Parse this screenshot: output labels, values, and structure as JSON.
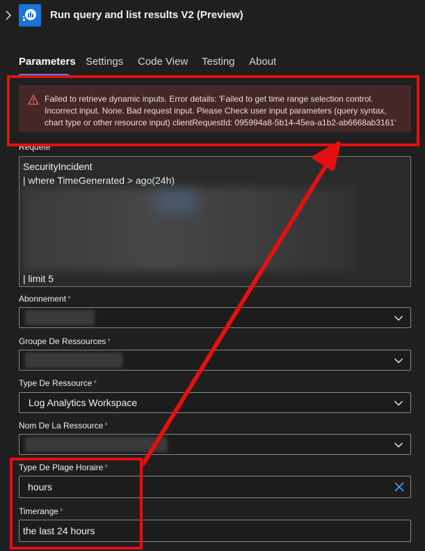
{
  "header": {
    "title": "Run query and list results V2 (Preview)"
  },
  "tabs": [
    {
      "label": "Parameters",
      "active": true
    },
    {
      "label": "Settings",
      "active": false
    },
    {
      "label": "Code View",
      "active": false
    },
    {
      "label": "Testing",
      "active": false
    },
    {
      "label": "About",
      "active": false
    }
  ],
  "error": {
    "message": "Failed to retrieve dynamic inputs. Error details: 'Failed to get time range selection control. Incorrect input. None. Bad request input. Please Check user input parameters (query syntax, chart type or other resource input) clientRequestId: 095994a8-5b14-45ea-a1b2-ab6668ab3161'"
  },
  "query": {
    "label": "Requete",
    "line1": "SecurityIncident",
    "line2": "| where TimeGenerated > ago(24h)",
    "line_last": "| limit 5"
  },
  "fields": {
    "subscription": {
      "label": "Abonnement",
      "required": "*",
      "value": ""
    },
    "resource_group": {
      "label": "Groupe De Ressources",
      "required": "*",
      "value": ""
    },
    "resource_type": {
      "label": "Type De Ressource",
      "required": "*",
      "value": "Log Analytics Workspace"
    },
    "resource_name": {
      "label": "Nom De La Ressource",
      "required": "*",
      "value": ""
    },
    "time_range_type": {
      "label": "Type De Plage Horaire",
      "required": "*",
      "value": "hours"
    },
    "timerange": {
      "label": "Timerange",
      "required": "*",
      "value": "the last 24 hours"
    }
  },
  "icons": {
    "expand": "chevron-right-icon",
    "app": "log-analytics-logo",
    "error": "warning-triangle-icon",
    "dropdown": "chevron-down-icon",
    "clear": "close-icon"
  },
  "colors": {
    "background": "#1f1f1f",
    "accent": "#3a8ef0",
    "error_bg": "#442726",
    "error_icon": "#f46a6a",
    "annotation": "#e60f0f"
  }
}
